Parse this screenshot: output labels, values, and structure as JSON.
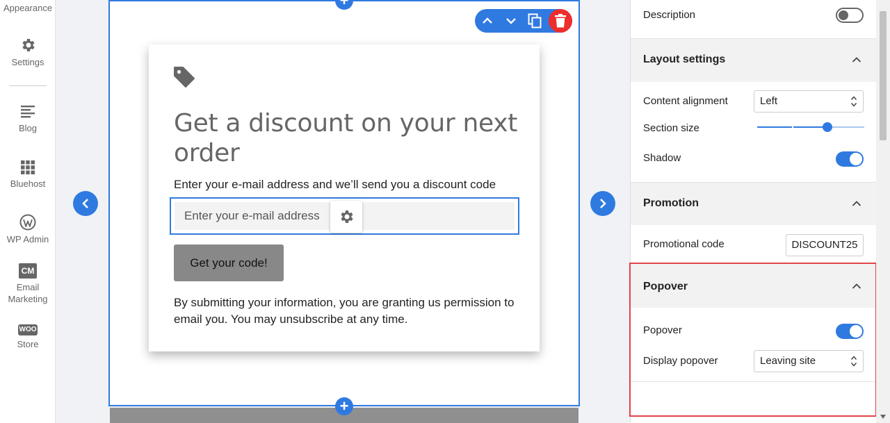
{
  "sidebar": {
    "items": [
      {
        "label": "Appearance",
        "icon": "appearance-icon"
      },
      {
        "label": "Settings",
        "icon": "gear-icon"
      },
      {
        "label": "Blog",
        "icon": "blog-icon"
      },
      {
        "label": "Bluehost",
        "icon": "grid-icon"
      },
      {
        "label": "WP Admin",
        "icon": "wordpress-icon"
      },
      {
        "label": "Email Marketing",
        "icon": "cm-icon",
        "badge": "CM"
      },
      {
        "label": "Store",
        "icon": "woo-icon",
        "badge": "WOO"
      }
    ]
  },
  "section": {
    "title": "Get a discount on your next order",
    "subtitle": "Enter your e-mail address and we’ll send you a discount code",
    "email_placeholder": "Enter your e-mail address",
    "cta_label": "Get your code!",
    "legal": "By submitting your information, you are granting us permission to email you. You may unsubscribe at any time."
  },
  "panel": {
    "description_label": "Description",
    "description_enabled": false,
    "layout_title": "Layout settings",
    "content_alignment_label": "Content alignment",
    "content_alignment_value": "Left",
    "section_size_label": "Section size",
    "section_size_level": 0.65,
    "shadow_label": "Shadow",
    "shadow_enabled": true,
    "promotion_title": "Promotion",
    "promo_code_label": "Promotional code",
    "promo_code_value": "DISCOUNT25",
    "popover_title": "Popover",
    "popover_label": "Popover",
    "popover_enabled": true,
    "display_popover_label": "Display popover",
    "display_popover_value": "Leaving site"
  },
  "colors": {
    "accent": "#2f7ae0",
    "delete": "#ee2d2d",
    "highlight": "#e2434b"
  }
}
